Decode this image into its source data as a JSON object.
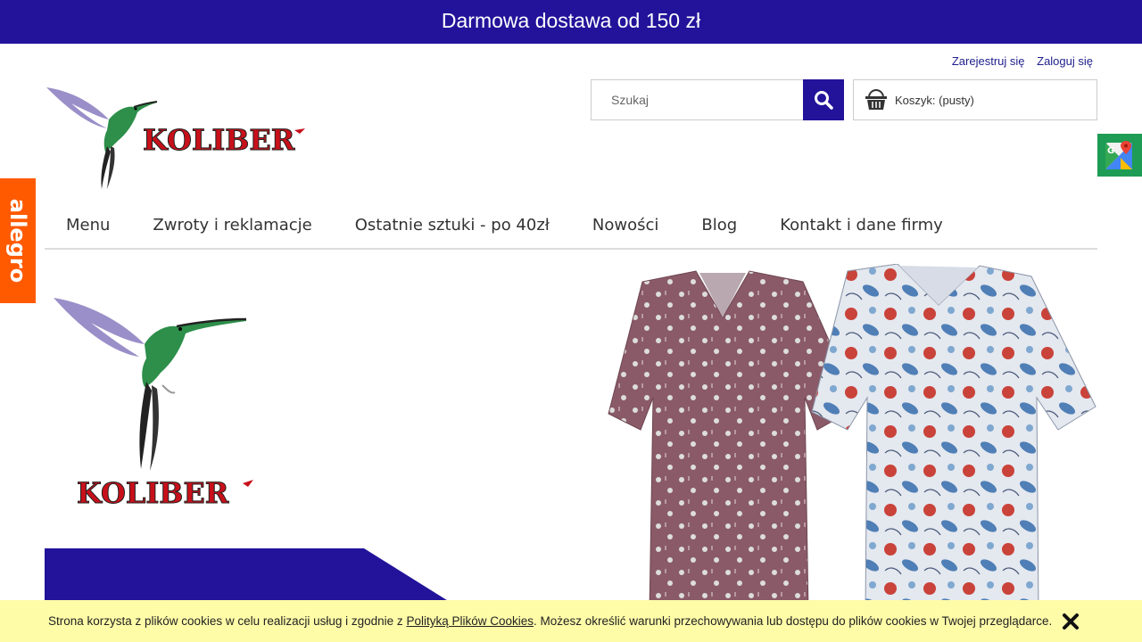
{
  "topbar": {
    "text": "Darmowa dostawa od 150 zł"
  },
  "account": {
    "register": "Zarejestruj się",
    "login": "Zaloguj się"
  },
  "logo": {
    "text": "KOLIBER"
  },
  "search": {
    "placeholder": "Szukaj",
    "icon": "search-icon"
  },
  "cart": {
    "label": "Koszyk:",
    "status": "(pusty)",
    "icon": "basket-icon"
  },
  "side": {
    "allegro": "allegro",
    "maps_icon": "google-maps-icon"
  },
  "nav": {
    "items": [
      {
        "label": "Menu"
      },
      {
        "label": "Zwroty i reklamacje"
      },
      {
        "label": "Ostatnie sztuki - po 40zł"
      },
      {
        "label": "Nowości"
      },
      {
        "label": "Blog"
      },
      {
        "label": "Kontakt i dane firmy"
      }
    ]
  },
  "hero": {
    "logo_text": "KOLIBER"
  },
  "cookie": {
    "text_before": "Strona korzysta z plików cookies w celu realizacji usług i zgodnie z ",
    "link": "Polityką Plików Cookies",
    "text_after": ". Możesz określić warunki przechowywania lub dostępu do plików cookies w Twojej przeglądarce.",
    "close_icon": "close-icon"
  },
  "colors": {
    "brand_blue": "#22139a",
    "allegro_orange": "#ff5a00",
    "cookie_bg": "#fffca8",
    "maps_green": "#1e9c55",
    "logo_red": "#c8101a"
  }
}
